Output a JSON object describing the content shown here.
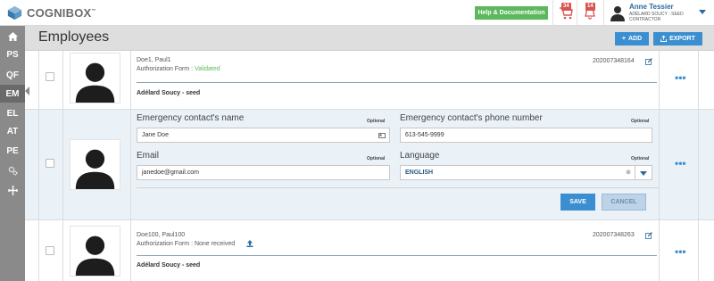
{
  "app": {
    "logo_text": "COGNIBOX",
    "logo_tm": "™",
    "help_label": "Help & Documentation",
    "cart_count": "34",
    "notif_count": "14",
    "user_name": "Anne Tessier",
    "user_sub_1": "ADÉLARD SOUCY - SEED",
    "user_sub_2": "CONTRACTOR"
  },
  "sidebar": {
    "items": [
      {
        "label": "PS"
      },
      {
        "label": "QF"
      },
      {
        "label": "EM"
      },
      {
        "label": "EL"
      },
      {
        "label": "AT"
      },
      {
        "label": "PE"
      }
    ]
  },
  "header": {
    "title": "Employees",
    "add_label": "ADD",
    "export_label": "EXPORT"
  },
  "employees": [
    {
      "name": "Doe1, Paul1",
      "auth_prefix": "Authorization Form : ",
      "auth_status": "Validated",
      "id": "202007348164",
      "supervisor": "Adélard Soucy - seed"
    },
    {
      "name": "Doe100, Paul100",
      "auth_prefix": "Authorization Form : ",
      "auth_status": "None received",
      "id": "202007348263",
      "supervisor": "Adélard Soucy - seed"
    }
  ],
  "form": {
    "emergency_name_label": "Emergency contact's name",
    "emergency_name_value": "Jane Doe",
    "emergency_phone_label": "Emergency contact's phone number",
    "emergency_phone_value": "613-545-9999",
    "email_label": "Email",
    "email_value": "janedoe@gmail.com",
    "language_label": "Language",
    "language_value": "ENGLISH",
    "optional_label": "Optional",
    "save_label": "SAVE",
    "cancel_label": "CANCEL",
    "clear_glyph": "⊗"
  },
  "menu_dots": "•••",
  "colors": {
    "accent": "#3b8fd0",
    "success": "#5cb85c",
    "badge": "#d9534f",
    "sidebar": "#8a8a8a"
  }
}
